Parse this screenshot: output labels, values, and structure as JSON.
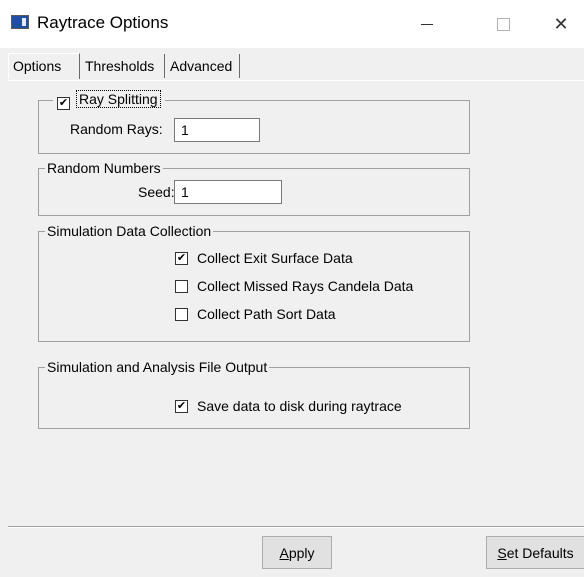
{
  "window": {
    "title": "Raytrace Options",
    "minimize_glyph": "",
    "maximize_glyph": "",
    "close_glyph": "✕"
  },
  "tabs": [
    {
      "label": "Options"
    },
    {
      "label": "Thresholds"
    },
    {
      "label": "Advanced"
    }
  ],
  "ray_splitting": {
    "label": "Ray Splitting",
    "checked": true,
    "check_glyph": "✔",
    "random_rays_label": "Random Rays:",
    "random_rays_value": "1"
  },
  "random_numbers": {
    "title": "Random Numbers",
    "seed_label": "Seed:",
    "seed_value": "1"
  },
  "data_collection": {
    "title": "Simulation Data Collection",
    "items": [
      {
        "label": "Collect Exit Surface Data",
        "checked": true,
        "glyph": "✔"
      },
      {
        "label": "Collect Missed Rays Candela Data",
        "checked": false,
        "glyph": ""
      },
      {
        "label": "Collect Path Sort Data",
        "checked": false,
        "glyph": ""
      }
    ]
  },
  "file_output": {
    "title": "Simulation and Analysis File Output",
    "save_label": "Save data to disk during raytrace",
    "save_checked": true,
    "save_glyph": "✔"
  },
  "buttons": {
    "apply_mnemonic": "A",
    "apply_rest": "pply",
    "defaults_mnemonic": "S",
    "defaults_rest": "et Defaults"
  },
  "icons": {
    "app": "app-window-icon",
    "minimize": "minimize-icon",
    "maximize": "maximize-icon",
    "close": "close-icon",
    "check": "checkmark-icon"
  }
}
